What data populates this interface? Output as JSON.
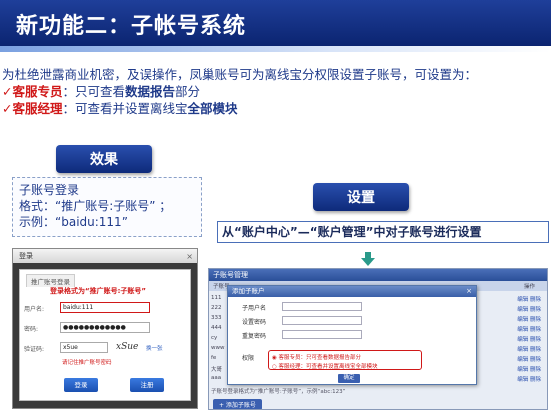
{
  "title": "新功能二：子帐号系统",
  "intro": "为杜绝泄露商业机密，及误操作，凤巢账号可为离线宝分权限设置子账号，可设置为：",
  "points": [
    {
      "check": "✓",
      "role": "客服专员",
      "text": "：只可查看",
      "highlight": "数据报告",
      "suffix": "部分"
    },
    {
      "check": "✓",
      "role": "客服经理",
      "text": "：可查看并设置离线宝",
      "highlight": "全部模块",
      "suffix": ""
    }
  ],
  "effect": {
    "label": "效果",
    "lines": [
      "子账号登录",
      "格式：“推广账号:子账号” ；",
      "示例：“baidu:111”"
    ]
  },
  "setting": {
    "label": "设置",
    "caption": "从“账户中心”—“账户管理”中对子账号进行设置"
  },
  "login_shot": {
    "window_title": "登录",
    "close": "×",
    "tab": "推广账号登录",
    "hint": "登录格式为“推广账号:子账号”",
    "username_label": "用户名:",
    "username_value": "baidu:111",
    "password_label": "密码:",
    "password_value": "●●●●●●●●●●●●",
    "captcha_label": "验证码:",
    "captcha_value": "x5ue",
    "captcha_image": "xSue",
    "captcha_refresh": "换一张",
    "remember": "请记住推广账号密码",
    "login_button": "登录",
    "register_button": "注册"
  },
  "settings_shot": {
    "header": "子账号管理",
    "col_name": "子账号",
    "col_op": "操作",
    "side_rows": [
      "111",
      "222",
      "333",
      "444",
      "cy",
      "www",
      "fe",
      "大哥",
      "aaa"
    ],
    "ops": [
      "编辑  删除",
      "编辑  删除",
      "编辑  删除",
      "编辑  删除",
      "编辑  删除",
      "编辑  删除",
      "编辑  删除",
      "编辑  删除",
      "编辑  删除"
    ],
    "footer": "子账号登录格式为“推广账号:子账号”，示例“abc:123”",
    "add_button": "+ 添加子账号",
    "dialog": {
      "title": "添加子账户",
      "close": "×",
      "field_name": "子用户名",
      "field_password": "设置密码",
      "field_confirm": "重复密码",
      "permission_label": "权限",
      "option_staff": "◉ 客服专员：只可查看数据报告部分",
      "option_manager": "○ 客服经理：可查看并设置离线宝全部模块",
      "confirm": "确定"
    }
  }
}
